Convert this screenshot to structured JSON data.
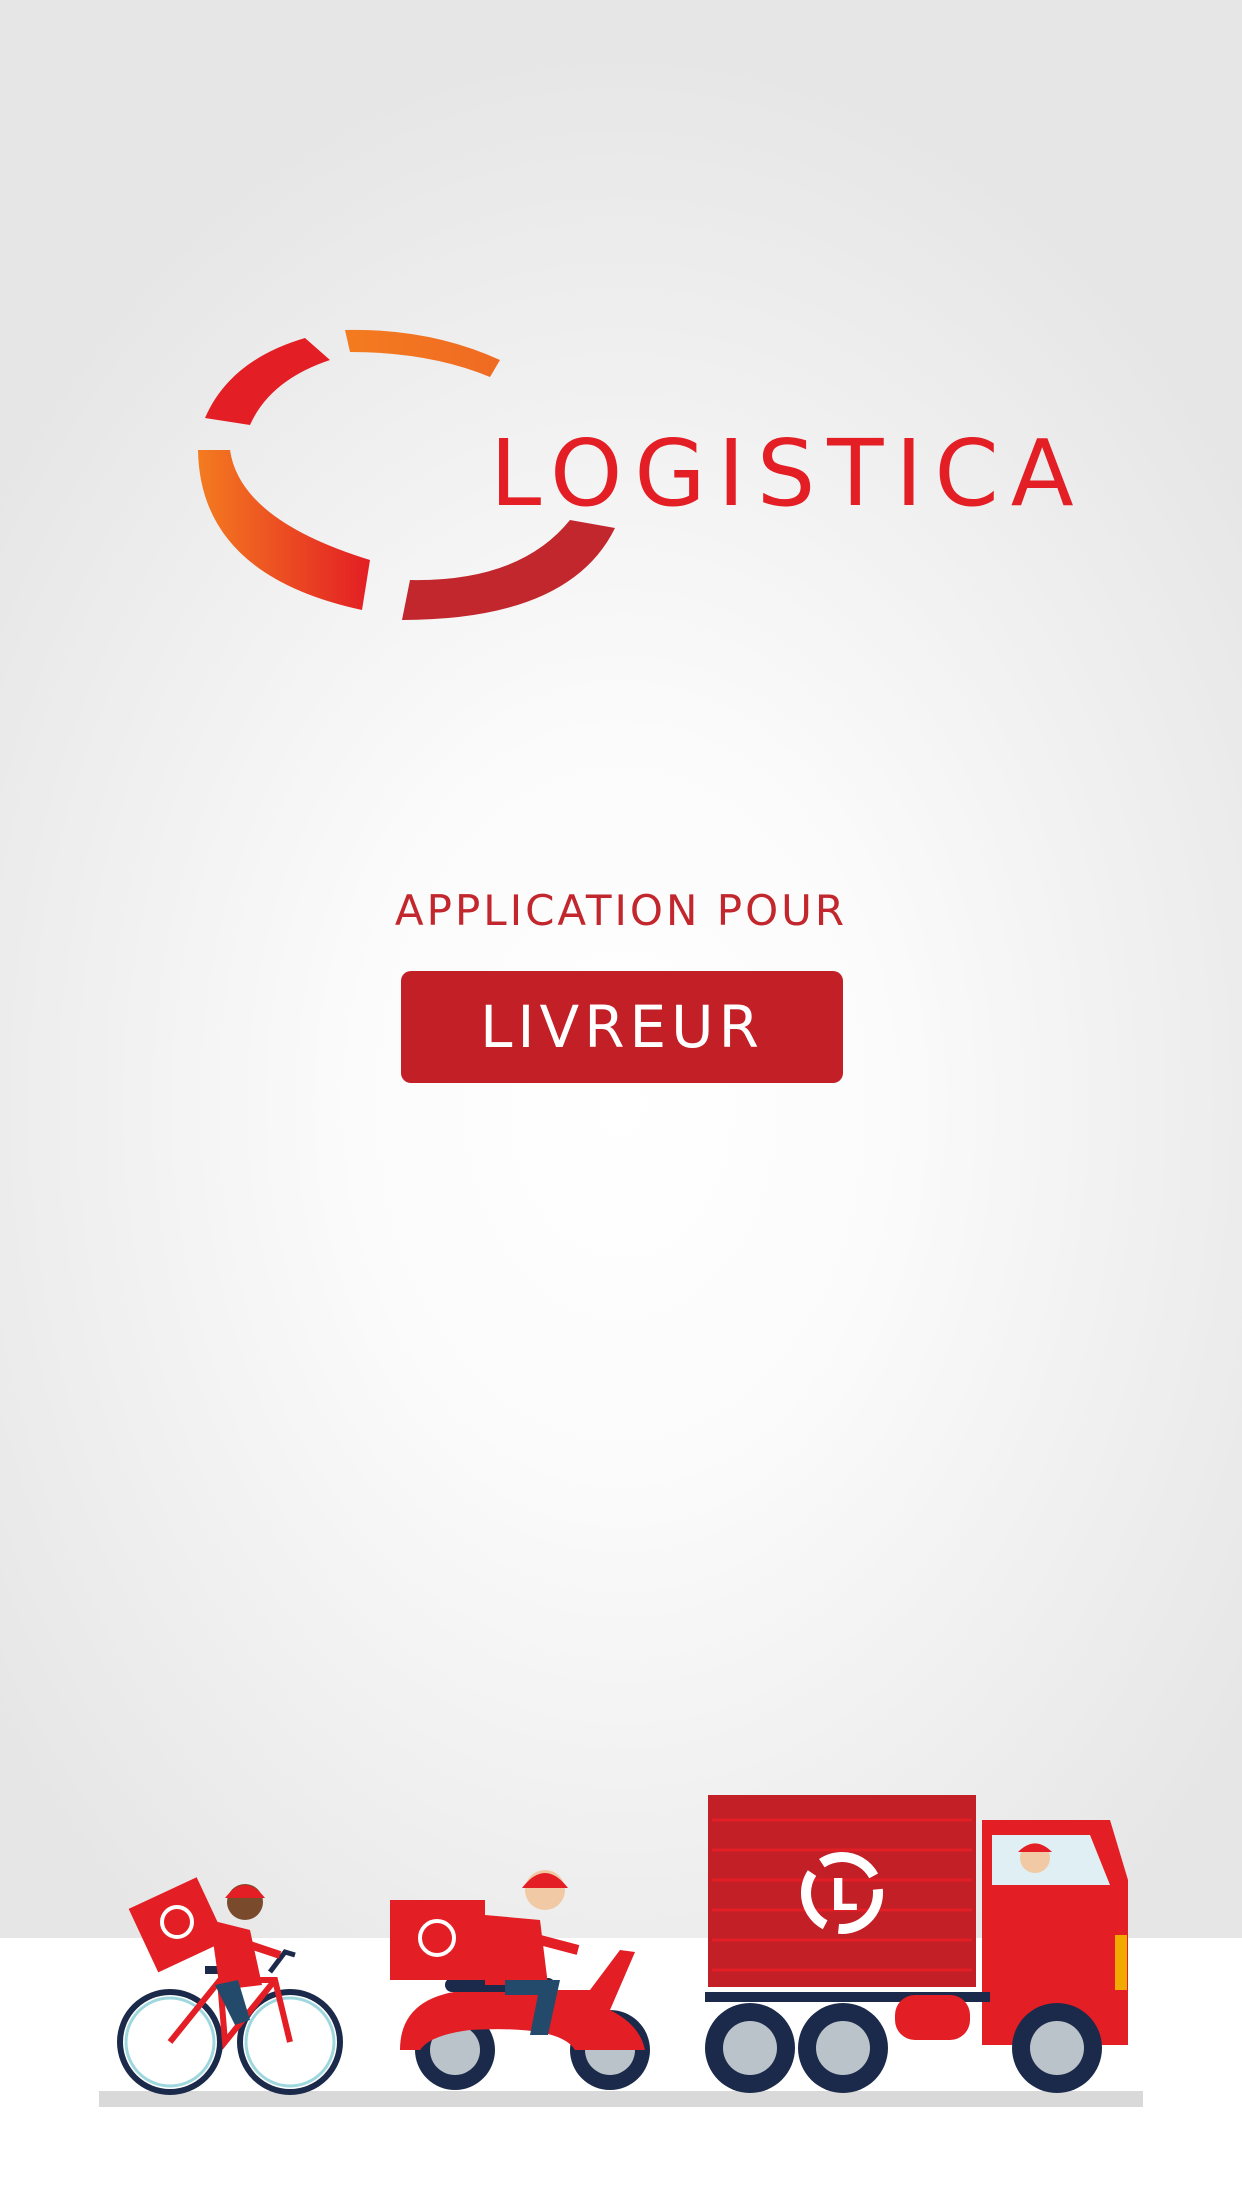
{
  "logo": {
    "text": "LOGISTICA",
    "colors": {
      "red": "#e31e24",
      "orange": "#f47b20",
      "dark_red": "#c1272d"
    }
  },
  "tagline": "APPLICATION POUR",
  "role_badge": "LIVREUR",
  "illustration": {
    "vehicles": [
      "bicycle-courier",
      "scooter-courier",
      "delivery-truck"
    ],
    "box_logo": "CL"
  },
  "colors": {
    "accent": "#c21f27",
    "background": "#f2f2f2"
  }
}
